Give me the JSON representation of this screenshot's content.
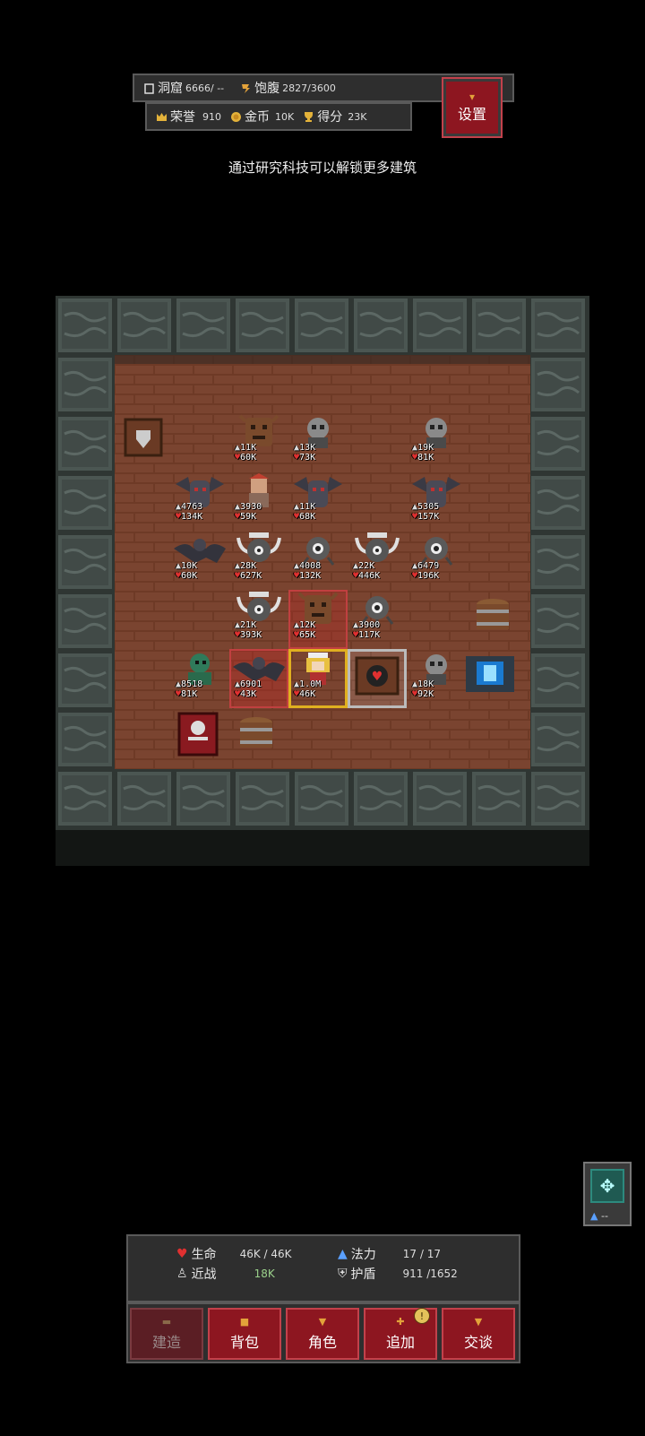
{
  "hud": {
    "cave_label": "洞窟",
    "cave_value": "6666/ --",
    "food_label": "饱腹",
    "food_value": "2827/3600",
    "honor_label": "荣誉",
    "honor_value": "910",
    "gold_label": "金币",
    "gold_value": "10K",
    "score_label": "得分",
    "score_value": "23K",
    "settings_label": "设置"
  },
  "hint": "通过研究科技可以解锁更多建筑",
  "colors": {
    "button_red": "#8d1620",
    "panel_gray": "#2e2e2e",
    "brick": "#6e3a26",
    "stone": "#454f4b"
  },
  "units": [
    {
      "kind": "tree",
      "atk": "11K",
      "hp": "60K"
    },
    {
      "kind": "skull",
      "atk": "13K",
      "hp": "73K"
    },
    {
      "kind": "skull",
      "atk": "19K",
      "hp": "81K"
    },
    {
      "kind": "gargoyle",
      "atk": "4763",
      "hp": "134K"
    },
    {
      "kind": "warrior",
      "atk": "3930",
      "hp": "59K"
    },
    {
      "kind": "gargoyle",
      "atk": "11K",
      "hp": "68K"
    },
    {
      "kind": "gargoyle",
      "atk": "5305",
      "hp": "157K"
    },
    {
      "kind": "bat",
      "atk": "10K",
      "hp": "60K"
    },
    {
      "kind": "horned",
      "atk": "28K",
      "hp": "627K"
    },
    {
      "kind": "eye",
      "atk": "4008",
      "hp": "132K"
    },
    {
      "kind": "horned",
      "atk": "22K",
      "hp": "446K"
    },
    {
      "kind": "eye",
      "atk": "6479",
      "hp": "196K"
    },
    {
      "kind": "horned",
      "atk": "21K",
      "hp": "393K"
    },
    {
      "kind": "tree",
      "atk": "12K",
      "hp": "65K"
    },
    {
      "kind": "eye",
      "atk": "3900",
      "hp": "117K"
    },
    {
      "kind": "ghoul",
      "atk": "8518",
      "hp": "81K"
    },
    {
      "kind": "bat",
      "atk": "6901",
      "hp": "43K"
    },
    {
      "kind": "hero",
      "atk": "1.0M",
      "hp": "46K"
    },
    {
      "kind": "skull",
      "atk": "18K",
      "hp": "92K"
    }
  ],
  "side_tool": {
    "icon": "crosshair-icon",
    "label": "--"
  },
  "stats": {
    "hp_label": "生命",
    "hp_value": "46K / 46K",
    "mp_label": "法力",
    "mp_value": "17  /  17",
    "melee_label": "近战",
    "melee_value": "18K",
    "shield_label": "护盾",
    "shield_value": "911 /1652"
  },
  "tabs": {
    "build": "建造",
    "bag": "背包",
    "character": "角色",
    "add": "追加",
    "talk": "交谈",
    "add_badge": "!"
  }
}
